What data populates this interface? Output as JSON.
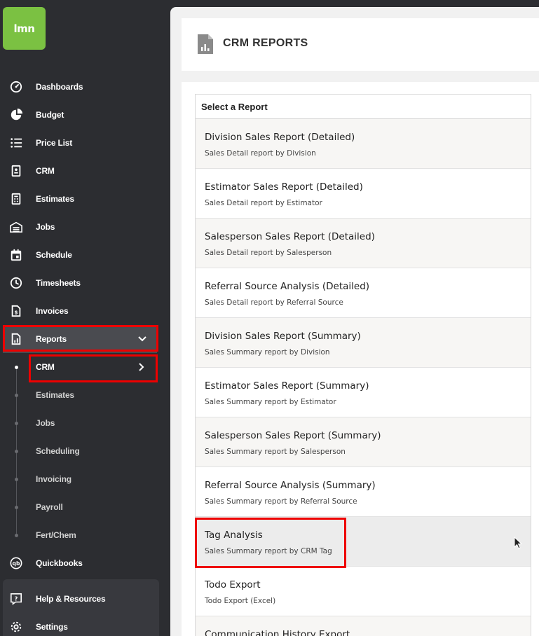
{
  "logo": {
    "text": "lmn"
  },
  "sidebar": {
    "items": [
      {
        "label": "Dashboards",
        "icon": "dashboard-icon"
      },
      {
        "label": "Budget",
        "icon": "pie-chart-icon"
      },
      {
        "label": "Price List",
        "icon": "list-icon"
      },
      {
        "label": "CRM",
        "icon": "contact-card-icon"
      },
      {
        "label": "Estimates",
        "icon": "calculator-icon"
      },
      {
        "label": "Jobs",
        "icon": "warehouse-icon"
      },
      {
        "label": "Schedule",
        "icon": "calendar-icon"
      },
      {
        "label": "Timesheets",
        "icon": "clock-icon"
      },
      {
        "label": "Invoices",
        "icon": "invoice-icon"
      },
      {
        "label": "Reports",
        "icon": "report-icon"
      }
    ],
    "report_sub_items": [
      {
        "label": "CRM"
      },
      {
        "label": "Estimates"
      },
      {
        "label": "Jobs"
      },
      {
        "label": "Scheduling"
      },
      {
        "label": "Invoicing"
      },
      {
        "label": "Payroll"
      },
      {
        "label": "Fert/Chem"
      }
    ],
    "quickbooks": {
      "label": "Quickbooks"
    },
    "help": {
      "label": "Help & Resources"
    },
    "settings": {
      "label": "Settings"
    }
  },
  "page": {
    "title": "CRM REPORTS"
  },
  "table": {
    "header": "Select a Report",
    "rows": [
      {
        "title": "Division Sales Report (Detailed)",
        "subtitle": "Sales Detail report by Division"
      },
      {
        "title": "Estimator Sales Report (Detailed)",
        "subtitle": "Sales Detail report by Estimator"
      },
      {
        "title": "Salesperson Sales Report (Detailed)",
        "subtitle": "Sales Detail report by Salesperson"
      },
      {
        "title": "Referral Source Analysis (Detailed)",
        "subtitle": "Sales Detail report by Referral Source"
      },
      {
        "title": "Division Sales Report (Summary)",
        "subtitle": "Sales Summary report by Division"
      },
      {
        "title": "Estimator Sales Report (Summary)",
        "subtitle": "Sales Summary report by Estimator"
      },
      {
        "title": "Salesperson Sales Report (Summary)",
        "subtitle": "Sales Summary report by Salesperson"
      },
      {
        "title": "Referral Source Analysis (Summary)",
        "subtitle": "Sales Summary report by Referral Source"
      },
      {
        "title": "Tag Analysis",
        "subtitle": "Sales Summary report by CRM Tag"
      },
      {
        "title": "Todo Export",
        "subtitle": "Todo Export (Excel)"
      },
      {
        "title": "Communication History Export",
        "subtitle": ""
      }
    ]
  },
  "colors": {
    "sidebar_bg": "#2c2d31",
    "brand_green": "#7bc142",
    "highlight_red": "#ee0000"
  }
}
